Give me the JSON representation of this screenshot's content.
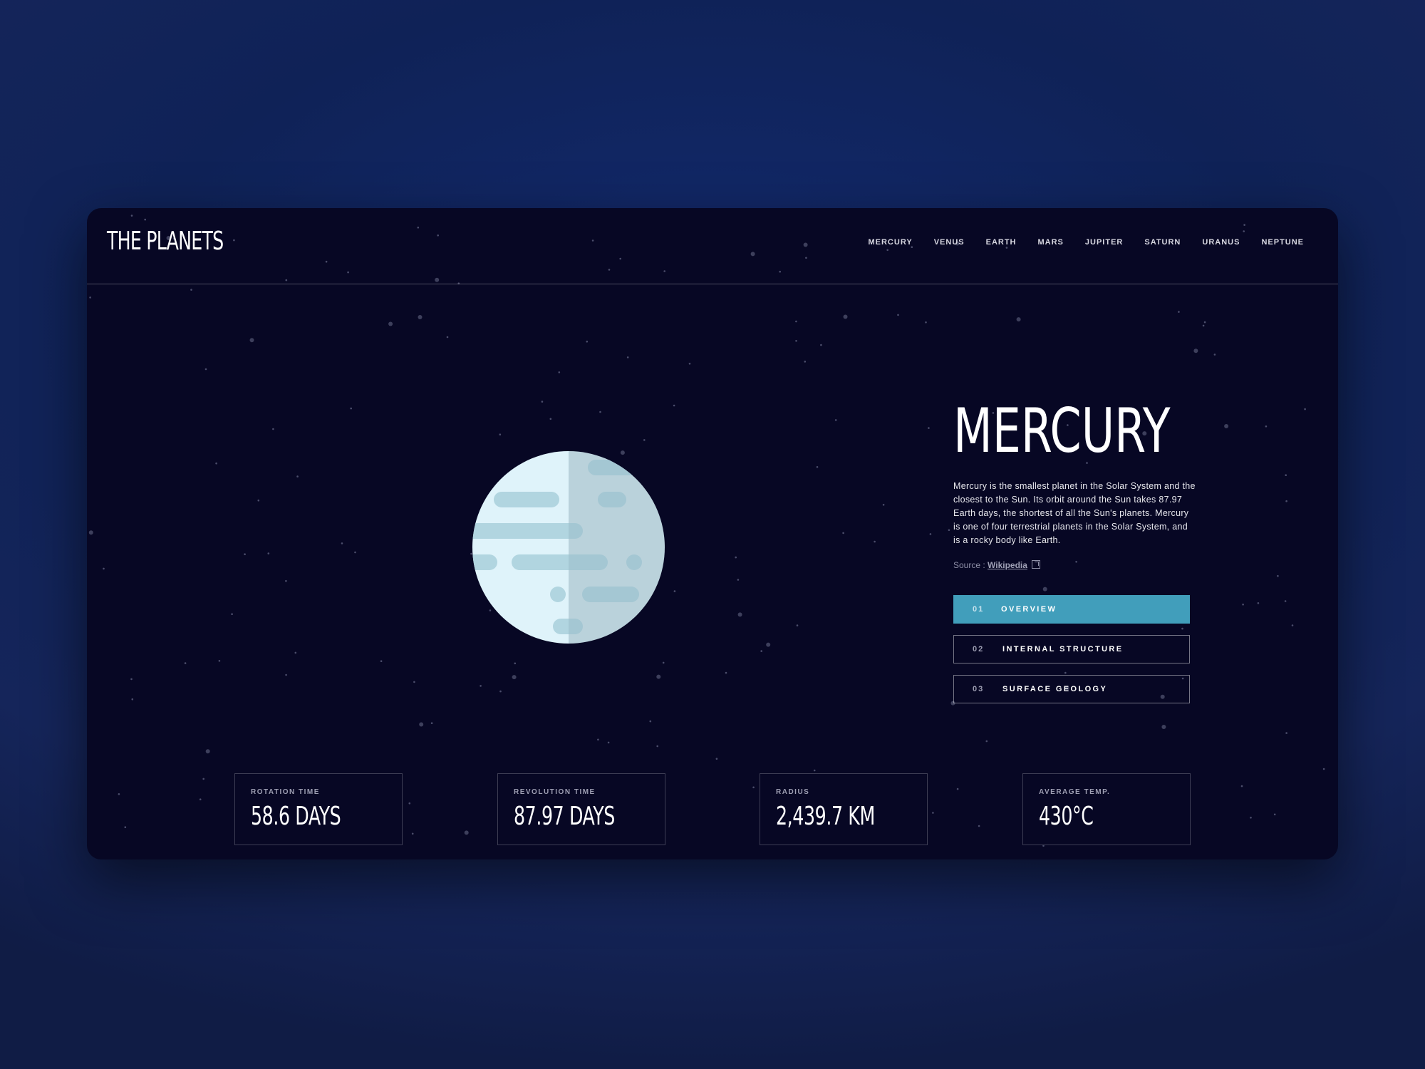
{
  "app": {
    "logo": "THE PLANETS"
  },
  "nav": {
    "items": [
      {
        "label": "MERCURY"
      },
      {
        "label": "VENUS"
      },
      {
        "label": "EARTH"
      },
      {
        "label": "MARS"
      },
      {
        "label": "JUPITER"
      },
      {
        "label": "SATURN"
      },
      {
        "label": "URANUS"
      },
      {
        "label": "NEPTUNE"
      }
    ]
  },
  "planet": {
    "name": "MERCURY",
    "description": "Mercury is the smallest planet in the Solar System and the closest to the Sun. Its orbit around the Sun takes 87.97 Earth days, the shortest of all the Sun's planets. Mercury is one of four terrestrial planets in the Solar System, and is a rocky body like Earth.",
    "source_prefix": "Source : ",
    "source_link": "Wikipedia",
    "image_icon": "mercury-planet-illustration"
  },
  "tabs": [
    {
      "num": "01",
      "label": "OVERVIEW",
      "active": true
    },
    {
      "num": "02",
      "label": "INTERNAL STRUCTURE",
      "active": false
    },
    {
      "num": "03",
      "label": "SURFACE GEOLOGY",
      "active": false
    }
  ],
  "stats": [
    {
      "label": "ROTATION TIME",
      "value": "58.6 DAYS"
    },
    {
      "label": "REVOLUTION TIME",
      "value": "87.97 DAYS"
    },
    {
      "label": "RADIUS",
      "value": "2,439.7 KM"
    },
    {
      "label": "AVERAGE TEMP.",
      "value": "430°C"
    }
  ],
  "colors": {
    "background": "#070724",
    "accent": "#419ebb",
    "outer_gradient": "#0f2257"
  }
}
